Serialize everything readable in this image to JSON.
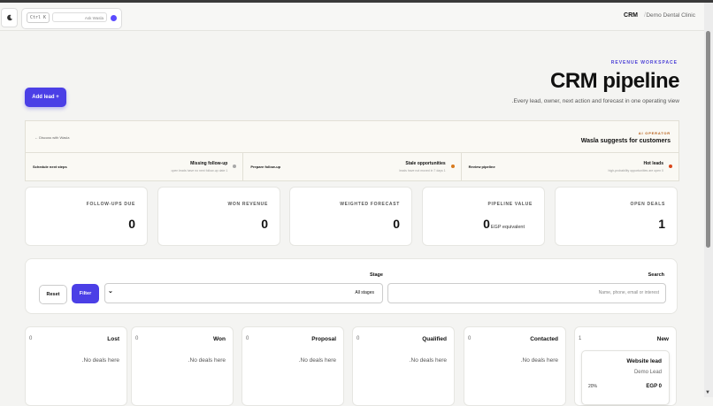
{
  "header": {
    "shortcut": "Ctrl K",
    "search_hint": "Ask Wasla",
    "app_name": "CRM",
    "separator": "/",
    "clinic": "Demo Dental Clinic"
  },
  "hero": {
    "eyebrow": "REVENUE WORKSPACE",
    "title": "CRM pipeline",
    "subtitle": ".Every lead, owner, next action and forecast in one operating view",
    "add_lead": "Add lead +"
  },
  "ai_panel": {
    "discuss": "← Discuss with Wasla",
    "label": "AI OPERATOR",
    "heading": "Wasla suggests for customers",
    "suggestions": [
      {
        "action": "Schedule next steps",
        "title": "Missing follow-up",
        "desc": "open leads have no next follow-up date 1",
        "dot_color": "#a8a8a8"
      },
      {
        "action": "Prepare follow-up",
        "title": "Stale opportunities",
        "desc": "leads have not moved in 7 days 1",
        "dot_color": "#d87a1d"
      },
      {
        "action": "Review pipeline",
        "title": "Hot leads",
        "desc": "high-probability opportunities are open 0",
        "dot_color": "#d9481c"
      }
    ]
  },
  "kpis": [
    {
      "label": "FOLLOW-UPS DUE",
      "value": "0"
    },
    {
      "label": "WON REVENUE",
      "value": "0"
    },
    {
      "label": "WEIGHTED FORECAST",
      "value": "0"
    },
    {
      "label": "PIPELINE VALUE",
      "value": "0",
      "unit": "EGP equivalent"
    },
    {
      "label": "OPEN DEALS",
      "value": "1"
    }
  ],
  "filters": {
    "stage_label": "Stage",
    "search_label": "Search",
    "reset": "Reset",
    "filter": "Filter",
    "stage_value": "All stages",
    "search_placeholder": "Name, phone, email or interest"
  },
  "columns": [
    {
      "name": "Lost",
      "count": "0",
      "empty": ".No deals here"
    },
    {
      "name": "Won",
      "count": "0",
      "empty": ".No deals here"
    },
    {
      "name": "Proposal",
      "count": "0",
      "empty": ".No deals here"
    },
    {
      "name": "Qualified",
      "count": "0",
      "empty": ".No deals here"
    },
    {
      "name": "Contacted",
      "count": "0",
      "empty": ".No deals here"
    },
    {
      "name": "New",
      "count": "1",
      "deal": {
        "title": "Website lead",
        "owner": "Demo Lead",
        "probability": "20%",
        "value": "EGP 0"
      }
    }
  ],
  "colors": {
    "accent": "#4b3fe6",
    "warning": "#d87a1d",
    "hot": "#d9481c"
  }
}
